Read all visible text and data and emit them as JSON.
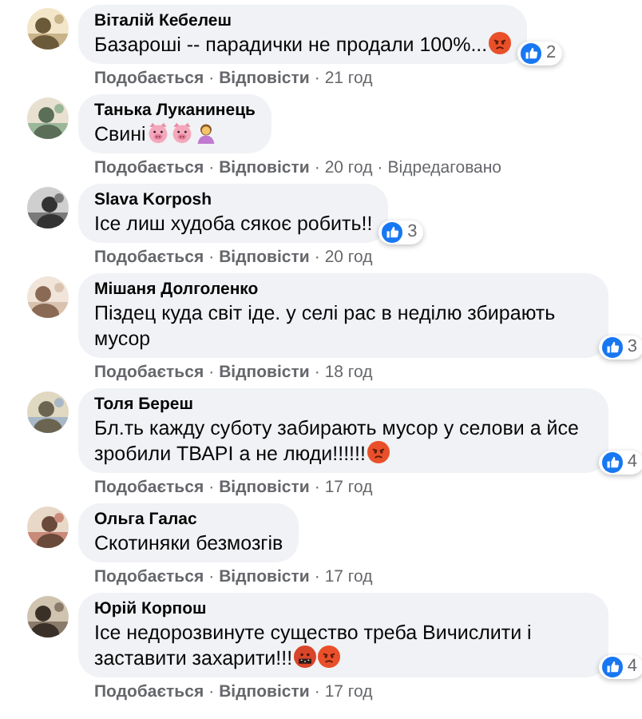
{
  "comments": [
    {
      "author": "Віталій Кебелеш",
      "text": "Базароші -- парадички не продали 100%...",
      "emojis": [
        {
          "kind": "angry"
        }
      ],
      "reactions": {
        "count": "2"
      },
      "meta": [
        {
          "kind": "action",
          "text": "Подобається"
        },
        {
          "kind": "sep",
          "text": "·"
        },
        {
          "kind": "action",
          "text": "Відповісти"
        },
        {
          "kind": "sep",
          "text": "·"
        },
        {
          "kind": "time",
          "text": "21 год"
        }
      ]
    },
    {
      "author": "Танька Луканинець",
      "text": "Свині",
      "emojis": [
        {
          "kind": "pig"
        },
        {
          "kind": "pig"
        },
        {
          "kind": "person"
        }
      ],
      "meta": [
        {
          "kind": "action",
          "text": "Подобається"
        },
        {
          "kind": "sep",
          "text": "·"
        },
        {
          "kind": "action",
          "text": "Відповісти"
        },
        {
          "kind": "sep",
          "text": "·"
        },
        {
          "kind": "time",
          "text": "20 год"
        },
        {
          "kind": "sep",
          "text": "·"
        },
        {
          "kind": "time",
          "text": "Відредаговано"
        }
      ]
    },
    {
      "author": "Slava Korposh",
      "text": "Ісе лиш худоба сякоє робить!!",
      "reactions": {
        "count": "3"
      },
      "meta": [
        {
          "kind": "action",
          "text": "Подобається"
        },
        {
          "kind": "sep",
          "text": "·"
        },
        {
          "kind": "action",
          "text": "Відповісти"
        },
        {
          "kind": "sep",
          "text": "·"
        },
        {
          "kind": "time",
          "text": "20 год"
        }
      ]
    },
    {
      "author": "Мішаня Долголенко",
      "text": "Піздец куда світ іде. у селі рас в неділю збирають мусор",
      "reactions": {
        "count": "3"
      },
      "meta": [
        {
          "kind": "action",
          "text": "Подобається"
        },
        {
          "kind": "sep",
          "text": "·"
        },
        {
          "kind": "action",
          "text": "Відповісти"
        },
        {
          "kind": "sep",
          "text": "·"
        },
        {
          "kind": "time",
          "text": "18 год"
        }
      ]
    },
    {
      "author": "Толя Береш",
      "text": "Бл.ть кажду суботу забирають мусор у селови а йсе зробили ТВАРІ а не люди!!!!!!",
      "emojis": [
        {
          "kind": "angry"
        }
      ],
      "reactions": {
        "count": "4"
      },
      "meta": [
        {
          "kind": "action",
          "text": "Подобається"
        },
        {
          "kind": "sep",
          "text": "·"
        },
        {
          "kind": "action",
          "text": "Відповісти"
        },
        {
          "kind": "sep",
          "text": "·"
        },
        {
          "kind": "time",
          "text": "17 год"
        }
      ]
    },
    {
      "author": "Ольга Галас",
      "text": "Скотиняки безмозгів",
      "meta": [
        {
          "kind": "action",
          "text": "Подобається"
        },
        {
          "kind": "sep",
          "text": "·"
        },
        {
          "kind": "action",
          "text": "Відповісти"
        },
        {
          "kind": "sep",
          "text": "·"
        },
        {
          "kind": "time",
          "text": "17 год"
        }
      ]
    },
    {
      "author": "Юрій Корпош",
      "text": "Ісе недорозвинуте существо треба Вичислити і заставити захарити!!!",
      "emojis": [
        {
          "kind": "cursing"
        },
        {
          "kind": "angry"
        }
      ],
      "reactions": {
        "count": "4"
      },
      "meta": [
        {
          "kind": "action",
          "text": "Подобається"
        },
        {
          "kind": "sep",
          "text": "·"
        },
        {
          "kind": "action",
          "text": "Відповісти"
        },
        {
          "kind": "sep",
          "text": "·"
        },
        {
          "kind": "time",
          "text": "17 год"
        }
      ]
    }
  ]
}
